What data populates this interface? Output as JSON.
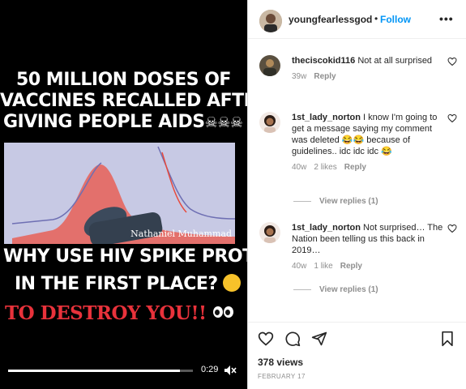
{
  "video": {
    "headline_lines": [
      "50 MILLION DOSES OF",
      "VACCINES RECALLED AFTER",
      "GIVING PEOPLE AIDS"
    ],
    "headline_emoji": "☠☠☠",
    "frame_label": "Nathaniel Muhammad",
    "question_lines": [
      "WHY USE HIV SPIKE PROTEIN",
      "IN THE FIRST PLACE?"
    ],
    "destroy_text": "TO DESTROY YOU!!",
    "time": "0:29",
    "progress": 0.93
  },
  "post": {
    "username": "youngfearlessgod",
    "separator": "•",
    "follow_label": "Follow",
    "more_label": "•••"
  },
  "comments": [
    {
      "username": "theciscokid116",
      "text": "Not at all surprised",
      "age": "39w",
      "likes": "",
      "reply_label": "Reply"
    },
    {
      "username": "1st_lady_norton",
      "text": "I know I'm going to get a message saying my comment was deleted 😂😂 because of guidelines.. idc idc idc 😂",
      "age": "40w",
      "likes": "2 likes",
      "reply_label": "Reply",
      "view_replies": "View replies (1)"
    },
    {
      "username": "1st_lady_norton",
      "text": "Not surprised… The Nation been telling us this back in 2019…",
      "age": "40w",
      "likes": "1 like",
      "reply_label": "Reply",
      "view_replies": "View replies (1)"
    }
  ],
  "footer": {
    "views": "378 views",
    "date": "FEBRUARY 17"
  },
  "colors": {
    "accent": "#0095f6",
    "red_text": "#e8323b"
  }
}
